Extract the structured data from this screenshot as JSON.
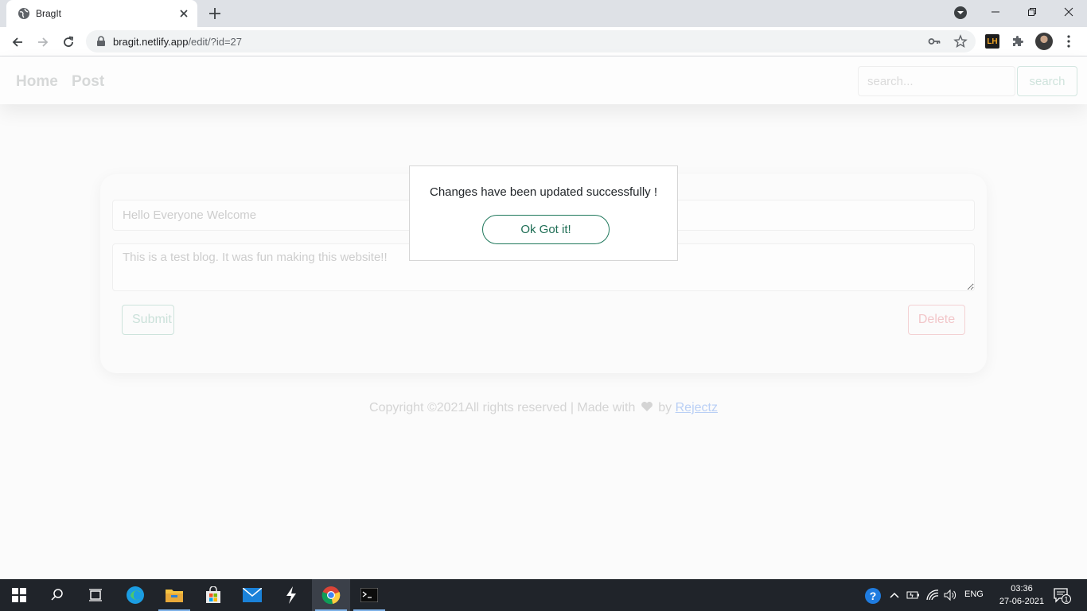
{
  "browser": {
    "tab_title": "BragIt",
    "url_host": "bragit.netlify.app",
    "url_path": "/edit/?id=27",
    "extension_badge": "LH"
  },
  "site": {
    "nav": {
      "home": "Home",
      "post": "Post"
    },
    "search": {
      "placeholder": "search...",
      "button": "search"
    },
    "form": {
      "title_value": "Hello Everyone Welcome",
      "body_value": "This is a test blog. It was fun making this website!!",
      "submit_label": "Submit",
      "delete_label": "Delete"
    },
    "footer": {
      "prefix": "Copyright ©2021All rights reserved | Made with",
      "by": "by",
      "author": "Rejectz"
    }
  },
  "modal": {
    "message": "Changes have been updated successfully !",
    "button": "Ok Got it!"
  },
  "taskbar": {
    "language": "ENG",
    "time": "03:36",
    "date": "27-06-2021",
    "notification_count": "1"
  },
  "colors": {
    "accent_green": "#1f6e55",
    "taskbar": "#20242a"
  }
}
